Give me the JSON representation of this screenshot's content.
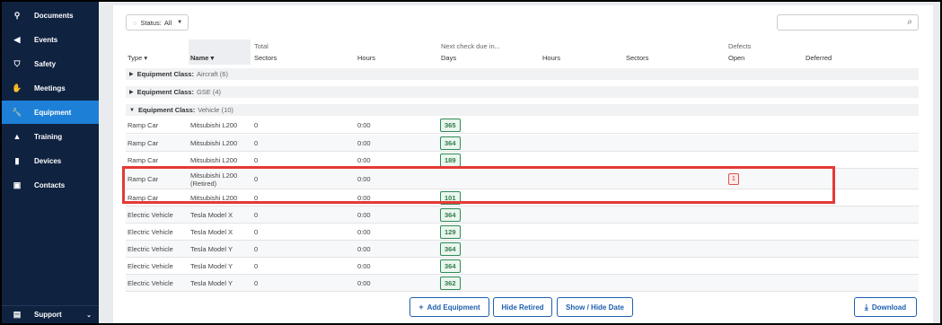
{
  "sidebar": {
    "items": [
      {
        "label": "Documents",
        "icon": "paperclip-icon",
        "glyph": "⚲"
      },
      {
        "label": "Events",
        "icon": "megaphone-icon",
        "glyph": "◀"
      },
      {
        "label": "Safety",
        "icon": "shield-icon",
        "glyph": "⛉"
      },
      {
        "label": "Meetings",
        "icon": "handshake-icon",
        "glyph": "✋"
      },
      {
        "label": "Equipment",
        "icon": "wrench-icon",
        "glyph": "🔧"
      },
      {
        "label": "Training",
        "icon": "graduation-cap-icon",
        "glyph": "▲"
      },
      {
        "label": "Devices",
        "icon": "tablet-icon",
        "glyph": "▮"
      },
      {
        "label": "Contacts",
        "icon": "contact-card-icon",
        "glyph": "▣"
      }
    ],
    "active": "Equipment",
    "support_label": "Support"
  },
  "toolbar": {
    "status_label": "Status:",
    "status_value": "All",
    "search_placeholder": ""
  },
  "table": {
    "group_headers": {
      "total": "Total",
      "next_check": "Next check due in...",
      "defects": "Defects"
    },
    "columns": {
      "type": "Type",
      "name": "Name",
      "total_sectors": "Sectors",
      "total_hours": "Hours",
      "next_days": "Days",
      "next_hours": "Hours",
      "next_sectors": "Sectors",
      "defects_open": "Open",
      "defects_deferred": "Deferred"
    },
    "groups": [
      {
        "label": "Equipment Class:",
        "value": "Aircraft (6)",
        "expanded": false
      },
      {
        "label": "Equipment Class:",
        "value": "GSE (4)",
        "expanded": false
      },
      {
        "label": "Equipment Class:",
        "value": "Vehicle (10)",
        "expanded": true
      }
    ],
    "rows": [
      {
        "type": "Ramp Car",
        "name": "Mitsubishi L200",
        "sectors": "0",
        "hours": "0:00",
        "days": "365",
        "open": ""
      },
      {
        "type": "Ramp Car",
        "name": "Mitsubishi L200",
        "sectors": "0",
        "hours": "0:00",
        "days": "364",
        "open": ""
      },
      {
        "type": "Ramp Car",
        "name": "Mitsubishi L200",
        "sectors": "0",
        "hours": "0:00",
        "days": "189",
        "open": ""
      },
      {
        "type": "Ramp Car",
        "name": "Mitsubishi L200 (Retired)",
        "sectors": "0",
        "hours": "0:00",
        "days": "",
        "open": "1"
      },
      {
        "type": "Ramp Car",
        "name": "Mitsubishi L200",
        "sectors": "0",
        "hours": "0:00",
        "days": "101",
        "open": ""
      },
      {
        "type": "Electric Vehicle",
        "name": "Tesla Model X",
        "sectors": "0",
        "hours": "0:00",
        "days": "364",
        "open": ""
      },
      {
        "type": "Electric Vehicle",
        "name": "Tesla Model X",
        "sectors": "0",
        "hours": "0:00",
        "days": "129",
        "open": ""
      },
      {
        "type": "Electric Vehicle",
        "name": "Tesla Model Y",
        "sectors": "0",
        "hours": "0:00",
        "days": "364",
        "open": ""
      },
      {
        "type": "Electric Vehicle",
        "name": "Tesla Model Y",
        "sectors": "0",
        "hours": "0:00",
        "days": "364",
        "open": ""
      },
      {
        "type": "Electric Vehicle",
        "name": "Tesla Model Y",
        "sectors": "0",
        "hours": "0:00",
        "days": "362",
        "open": ""
      }
    ]
  },
  "buttons": {
    "add_equipment": "Add Equipment",
    "hide_retired": "Hide Retired",
    "show_hide_date": "Show / Hide Date",
    "download": "Download"
  },
  "colors": {
    "sidebar_bg": "#0f2240",
    "sidebar_active": "#1d7fd6",
    "badge_green": "#2e8b57",
    "highlight_red": "#e53935",
    "button_blue": "#1d5fb0"
  }
}
